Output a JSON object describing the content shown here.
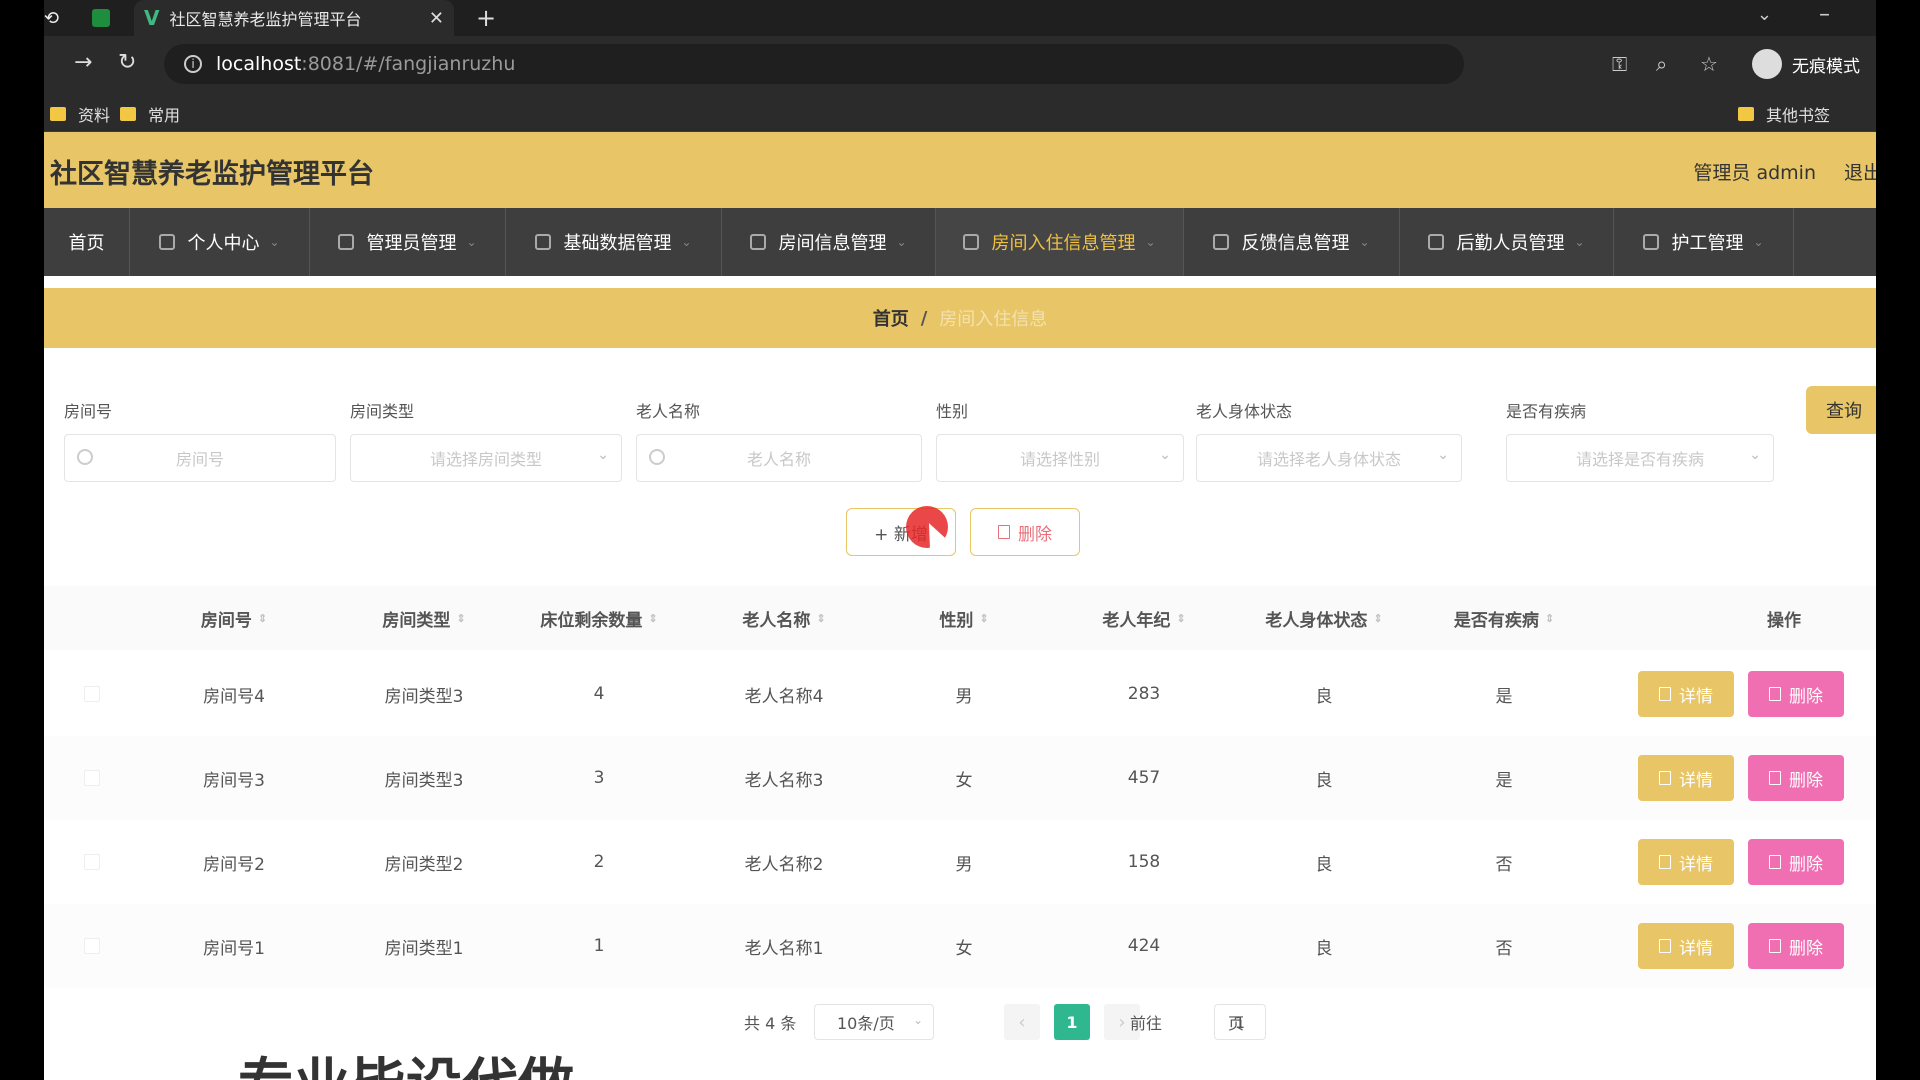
{
  "browser": {
    "tab_title": "社区智慧养老监护管理平台",
    "url_host": "localhost",
    "url_rest": ":8081/#/fangjianruzhu",
    "profile_label": "无痕模式",
    "bookmarks": [
      "资料",
      "常用"
    ],
    "other_bookmarks": "其他书签"
  },
  "app": {
    "title": "社区智慧养老监护管理平台",
    "admin_label": "管理员 admin",
    "logout_label": "退出",
    "nav": [
      {
        "label": "首页"
      },
      {
        "label": "个人中心"
      },
      {
        "label": "管理员管理"
      },
      {
        "label": "基础数据管理"
      },
      {
        "label": "房间信息管理"
      },
      {
        "label": "房间入住信息管理"
      },
      {
        "label": "反馈信息管理"
      },
      {
        "label": "后勤人员管理"
      },
      {
        "label": "护工管理"
      }
    ],
    "breadcrumb": {
      "home": "首页",
      "separator": "/",
      "current": "房间入住信息"
    }
  },
  "filters": {
    "room_no": {
      "label": "房间号",
      "placeholder": "房间号"
    },
    "room_type": {
      "label": "房间类型",
      "placeholder": "请选择房间类型"
    },
    "elder_name": {
      "label": "老人名称",
      "placeholder": "老人名称"
    },
    "gender": {
      "label": "性别",
      "placeholder": "请选择性别"
    },
    "health": {
      "label": "老人身体状态",
      "placeholder": "请选择老人身体状态"
    },
    "disease": {
      "label": "是否有疾病",
      "placeholder": "请选择是否有疾病"
    },
    "query_label": "查询"
  },
  "actions": {
    "add_label": "+ 新增",
    "delete_label": "删除"
  },
  "table": {
    "columns": [
      "房间号",
      "房间类型",
      "床位剩余数量",
      "老人名称",
      "性别",
      "老人年纪",
      "老人身体状态",
      "是否有疾病",
      "操作"
    ],
    "rows": [
      {
        "room_no": "房间号4",
        "room_type": "房间类型3",
        "beds": "4",
        "name": "老人名称4",
        "gender": "男",
        "age": "283",
        "health": "良",
        "disease": "是"
      },
      {
        "room_no": "房间号3",
        "room_type": "房间类型3",
        "beds": "3",
        "name": "老人名称3",
        "gender": "女",
        "age": "457",
        "health": "良",
        "disease": "是"
      },
      {
        "room_no": "房间号2",
        "room_type": "房间类型2",
        "beds": "2",
        "name": "老人名称2",
        "gender": "男",
        "age": "158",
        "health": "良",
        "disease": "否"
      },
      {
        "room_no": "房间号1",
        "room_type": "房间类型1",
        "beds": "1",
        "name": "老人名称1",
        "gender": "女",
        "age": "424",
        "health": "良",
        "disease": "否"
      }
    ],
    "detail_label": "详情",
    "delete_label": "删除"
  },
  "pagination": {
    "total": "共 4 条",
    "page_size": "10条/页",
    "current_page": "1",
    "goto_prefix": "前往",
    "goto_value": "1",
    "goto_suffix": "页"
  },
  "overlay_text": "专业毕设代做"
}
